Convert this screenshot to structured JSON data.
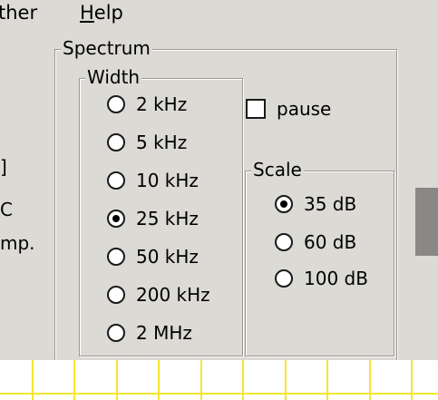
{
  "menubar": {
    "items": [
      {
        "prefix": "",
        "mnemonic": "",
        "rest": "ther"
      },
      {
        "prefix": "",
        "mnemonic": "H",
        "rest": "elp"
      }
    ]
  },
  "left_partial": {
    "bracket": "]",
    "line1": "C",
    "line2": "mp."
  },
  "spectrum": {
    "title": "Spectrum",
    "width_group": {
      "title": "Width",
      "options": [
        {
          "label": "2 kHz",
          "checked": false
        },
        {
          "label": "5 kHz",
          "checked": false
        },
        {
          "label": "10 kHz",
          "checked": false
        },
        {
          "label": "25 kHz",
          "checked": true
        },
        {
          "label": "50 kHz",
          "checked": false
        },
        {
          "label": "200 kHz",
          "checked": false
        },
        {
          "label": "2 MHz",
          "checked": false
        }
      ]
    },
    "pause": {
      "label": "pause",
      "checked": false
    },
    "scale_group": {
      "title": "Scale",
      "options": [
        {
          "label": "35 dB",
          "checked": true
        },
        {
          "label": "60 dB",
          "checked": false
        },
        {
          "label": "100 dB",
          "checked": false
        }
      ]
    }
  },
  "colors": {
    "panel_bg": "#dcdad5",
    "grid_line": "#f5e62e",
    "scroll_thumb": "#8a8884"
  }
}
